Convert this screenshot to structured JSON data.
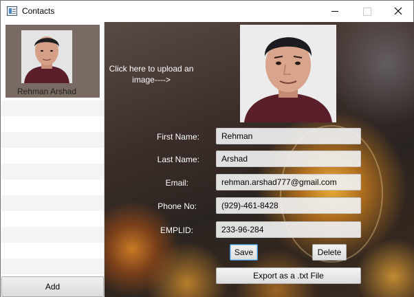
{
  "window": {
    "title": "Contacts"
  },
  "sidebar": {
    "contacts": [
      {
        "name": "Rehman Arshad"
      }
    ],
    "add_label": "Add"
  },
  "main": {
    "upload_hint": "Click here to upload an image---->",
    "fields": {
      "first_name": {
        "label": "First Name:",
        "value": "Rehman"
      },
      "last_name": {
        "label": "Last Name:",
        "value": "Arshad"
      },
      "email": {
        "label": "Email:",
        "value": "rehman.arshad777@gmail.com"
      },
      "phone": {
        "label": "Phone No:",
        "value": "(929)-461-8428"
      },
      "emplid": {
        "label": "EMPLID:",
        "value": "233-96-284"
      }
    },
    "buttons": {
      "save": "Save",
      "delete": "Delete",
      "export": "Export as a .txt File"
    }
  }
}
